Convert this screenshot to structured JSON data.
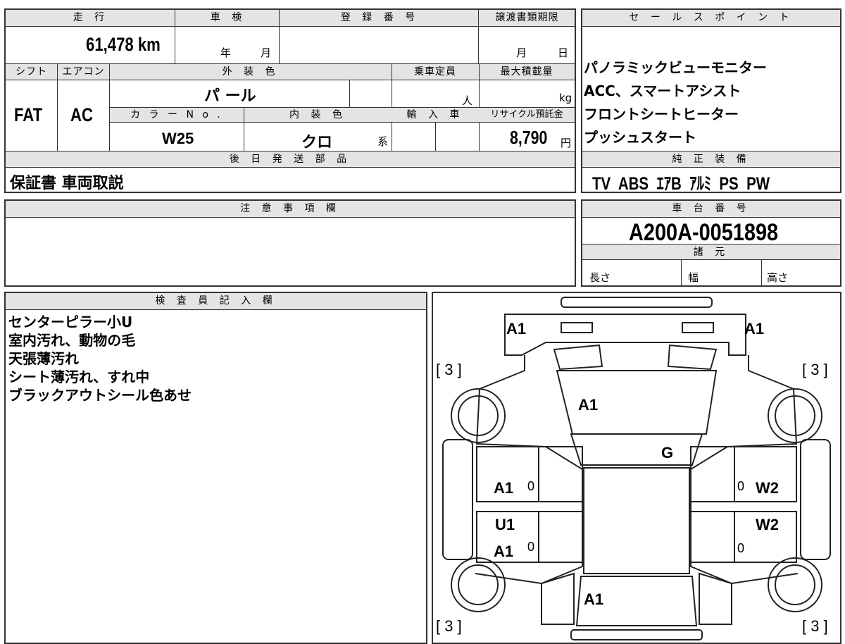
{
  "mileage": {
    "label": "走 行",
    "value": "61,478 km"
  },
  "inspection": {
    "label": "車 検",
    "year": "年",
    "month": "月"
  },
  "registration": {
    "label": "登 録 番 号",
    "value": ""
  },
  "transfer_deadline": {
    "label": "譲渡書類期限",
    "month": "月",
    "day": "日"
  },
  "shift": {
    "label": "シフト",
    "value": "FAT"
  },
  "aircon": {
    "label": "エアコン",
    "value": "AC"
  },
  "exterior_color": {
    "label": "外 装 色",
    "value": "パ ール"
  },
  "capacity": {
    "label": "乗車定員",
    "unit": "人"
  },
  "max_load": {
    "label": "最大積載量",
    "unit": "kg"
  },
  "color_no": {
    "label": "カ ラ ー N o .",
    "value": "W25"
  },
  "interior_color": {
    "label": "内 装 色",
    "value": "クロ",
    "suffix": "系"
  },
  "import": {
    "label": "輸 入 車"
  },
  "recycle": {
    "label": "リサイクル預託金",
    "value": "8,790",
    "unit": "円"
  },
  "later_parts": {
    "label": "後 日 発 送 部 品",
    "value": "保証書 車両取説"
  },
  "sales_points": {
    "label": "セ ー ル ス ポ イ ン ト",
    "items": [
      "パノラミックビューモニター",
      "ACC、スマートアシスト",
      "フロントシートヒーター",
      "プッシュスタート"
    ]
  },
  "genuine_equipment": {
    "label": "純 正 装 備",
    "value": "TV  ABS  ｴｱB  ｱﾙﾐ  PS  PW"
  },
  "caution": {
    "label": "注 意 事 項 欄",
    "value": ""
  },
  "chassis_no": {
    "label": "車 台 番 号",
    "value": "A200A-0051898"
  },
  "specs": {
    "label": "諸 元",
    "length": "長さ",
    "width": "幅",
    "height": "高さ"
  },
  "inspector": {
    "label": "検 査 員 記 入 欄",
    "notes": [
      "センターピラー小U",
      "室内汚れ、動物の毛",
      "天張薄汚れ",
      "シート薄汚れ、すれ中",
      "ブラックアウトシール色あせ"
    ]
  },
  "diagram": {
    "tl": "A1",
    "tr": "A1",
    "tire_fl": "[ 3 ]",
    "tire_fr": "[ 3 ]",
    "tire_rl": "[ 3 ]",
    "tire_rr": "[ 3 ]",
    "hood": "A1",
    "windshield": "G",
    "left_front_door": "A1",
    "left_front_door_num": "0",
    "left_pillar": "U1",
    "left_rear_door": "A1",
    "left_rear_door_num": "0",
    "right_front_door": "W2",
    "right_front_door_num": "0",
    "right_rear_door": "W2",
    "right_rear_door_num": "0",
    "rear": "A1"
  }
}
